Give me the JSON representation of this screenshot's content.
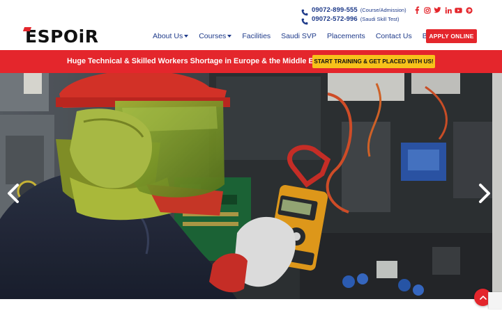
{
  "contact": {
    "phone1": "09072-899-555",
    "phone1_note": "(Course/Admission)",
    "phone2": "09072-572-996",
    "phone2_note": "(Saudi Skill Test)",
    "socials": [
      "facebook-icon",
      "instagram-icon",
      "twitter-icon",
      "linkedin-icon",
      "youtube-icon",
      "pinterest-icon"
    ]
  },
  "logo": {
    "text": "ESPOiR"
  },
  "nav": {
    "items": [
      {
        "label": "About Us",
        "dropdown": true
      },
      {
        "label": "Courses",
        "dropdown": true
      },
      {
        "label": "Facilities",
        "dropdown": false
      },
      {
        "label": "Saudi SVP",
        "dropdown": false
      },
      {
        "label": "Placements",
        "dropdown": false
      },
      {
        "label": "Contact Us",
        "dropdown": false
      },
      {
        "label": "Blog",
        "dropdown": false
      }
    ],
    "apply_label": "APPLY ONLINE"
  },
  "banner": {
    "text": "Huge Technical & Skilled Workers Shortage in Europe & the Middle East.",
    "cta": "START TRAINING & GET PLACED WITH US!"
  },
  "hero": {
    "prev_icon": "chevron-left-icon",
    "next_icon": "chevron-right-icon"
  },
  "colors": {
    "brand_red": "#e4262c",
    "brand_blue": "#1f3b8a",
    "cta_yellow": "#f7c21a"
  }
}
